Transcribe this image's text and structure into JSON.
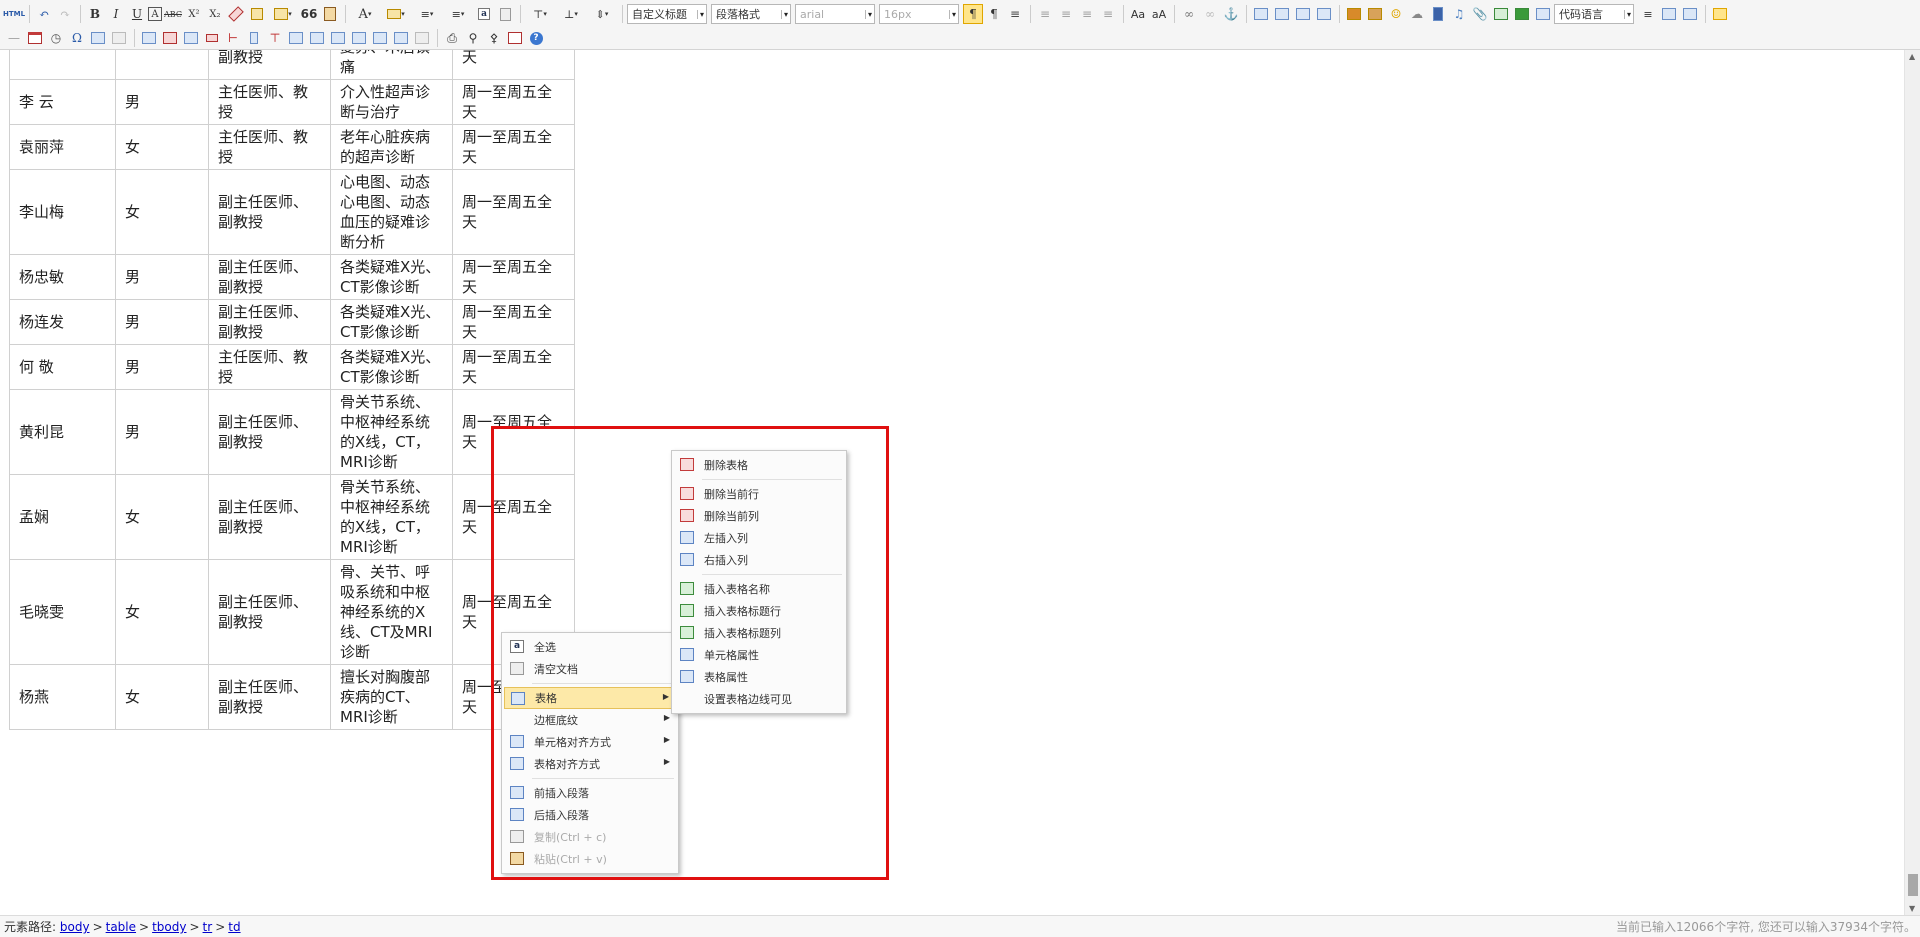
{
  "toolbar": {
    "combos": {
      "custom_heading": "自定义标题",
      "paragraph_format": "段落格式",
      "font_family": "arial",
      "font_size": "16px",
      "code_language": "代码语言"
    },
    "icons": [
      "html-source-icon",
      "undo-icon",
      "redo-icon",
      "bold-icon",
      "italic-icon",
      "underline-icon",
      "font-border-icon",
      "strikethrough-icon",
      "superscript-icon",
      "subscript-icon",
      "remove-format-icon",
      "format-match-icon",
      "auto-typeset-icon",
      "blockquote-icon",
      "paste-plain-icon",
      "font-color-icon",
      "back-color-icon",
      "ordered-list-icon",
      "unordered-list-icon",
      "select-all-icon",
      "clear-doc-icon"
    ],
    "labels": {
      "html": "HTML",
      "bold": "B",
      "italic": "I",
      "underline": "U",
      "font_border": "A",
      "strike": "ABC",
      "sup": "X²",
      "sub": "X₂",
      "quote": "66",
      "font_color": "A",
      "omega": "Ω",
      "select_all": "a"
    }
  },
  "table": {
    "rows": [
      {
        "name": "",
        "gender": "",
        "title": "副教授",
        "specialty": "复苏、术后镇痛",
        "schedule": "天",
        "partial": true
      },
      {
        "name": "李 云",
        "gender": "男",
        "title": "主任医师、教授",
        "specialty": "介入性超声诊断与治疗",
        "schedule": "周一至周五全天"
      },
      {
        "name": "袁丽萍",
        "gender": "女",
        "title": "主任医师、教授",
        "specialty": "老年心脏疾病的超声诊断",
        "schedule": "周一至周五全天"
      },
      {
        "name": "李山梅",
        "gender": "女",
        "title": "副主任医师、副教授",
        "specialty": "心电图、动态心电图、动态血压的疑难诊断分析",
        "schedule": "周一至周五全天"
      },
      {
        "name": "杨忠敏",
        "gender": "男",
        "title": "副主任医师、副教授",
        "specialty": "各类疑难X光、CT影像诊断",
        "schedule": "周一至周五全天"
      },
      {
        "name": "杨连发",
        "gender": "男",
        "title": "副主任医师、副教授",
        "specialty": "各类疑难X光、CT影像诊断",
        "schedule": "周一至周五全天"
      },
      {
        "name": "何 敬",
        "gender": "男",
        "title": "主任医师、教授",
        "specialty": "各类疑难X光、CT影像诊断",
        "schedule": "周一至周五全天"
      },
      {
        "name": "黄利昆",
        "gender": "男",
        "title": "副主任医师、副教授",
        "specialty": "骨关节系统、中枢神经系统的X线，CT，MRI诊断",
        "schedule": "周一至周五全天"
      },
      {
        "name": "孟娴",
        "gender": "女",
        "title": "副主任医师、副教授",
        "specialty": "骨关节系统、中枢神经系统的X线，CT，MRI诊断",
        "schedule": "周一至周五全天"
      },
      {
        "name": "毛晓雯",
        "gender": "女",
        "title": "副主任医师、副教授",
        "specialty": "骨、关节、呼吸系统和中枢神经系统的X线、CT及MRI诊断",
        "schedule": "周一至周五全天"
      },
      {
        "name": "杨燕",
        "gender": "女",
        "title": "副主任医师、副教授",
        "specialty": "擅长对胸腹部疾病的CT、MRI诊断",
        "schedule": "周一至周五全天"
      }
    ]
  },
  "context_menu": {
    "items": [
      {
        "label": "全选",
        "icon": "select-all-icon"
      },
      {
        "label": "清空文档",
        "icon": "clear-doc-icon"
      },
      {
        "label": "表格",
        "icon": "table-icon",
        "submenu": true,
        "hover": true
      },
      {
        "label": "边框底纹",
        "icon": "",
        "submenu": true
      },
      {
        "label": "单元格对齐方式",
        "icon": "cell-align-icon",
        "submenu": true
      },
      {
        "label": "表格对齐方式",
        "icon": "table-align-icon",
        "submenu": true
      },
      {
        "label": "前插入段落",
        "icon": "insert-para-before-icon"
      },
      {
        "label": "后插入段落",
        "icon": "insert-para-after-icon"
      },
      {
        "label": "复制(Ctrl + c)",
        "icon": "copy-icon",
        "disabled": true
      },
      {
        "label": "粘贴(Ctrl + v)",
        "icon": "paste-icon",
        "disabled": true
      }
    ]
  },
  "table_submenu": {
    "items": [
      {
        "label": "删除表格",
        "icon": "delete-table-icon"
      },
      {
        "label": "删除当前行",
        "icon": "delete-row-icon"
      },
      {
        "label": "删除当前列",
        "icon": "delete-col-icon"
      },
      {
        "label": "左插入列",
        "icon": "insert-col-left-icon"
      },
      {
        "label": "右插入列",
        "icon": "insert-col-right-icon"
      },
      {
        "label": "插入表格名称",
        "icon": "insert-caption-icon"
      },
      {
        "label": "插入表格标题行",
        "icon": "insert-title-row-icon"
      },
      {
        "label": "插入表格标题列",
        "icon": "insert-title-col-icon"
      },
      {
        "label": "单元格属性",
        "icon": "cell-props-icon"
      },
      {
        "label": "表格属性",
        "icon": "table-props-icon"
      },
      {
        "label": "设置表格边线可见",
        "icon": ""
      }
    ]
  },
  "statusbar": {
    "path_label": "元素路径:",
    "path": [
      "body",
      "table",
      "tbody",
      "tr",
      "td"
    ],
    "count_text": "当前已输入12066个字符, 您还可以输入37934个字符。"
  },
  "colors": {
    "highlight": "#e01010",
    "menu_hover": "#fde9a8",
    "link": "#0000cc"
  }
}
